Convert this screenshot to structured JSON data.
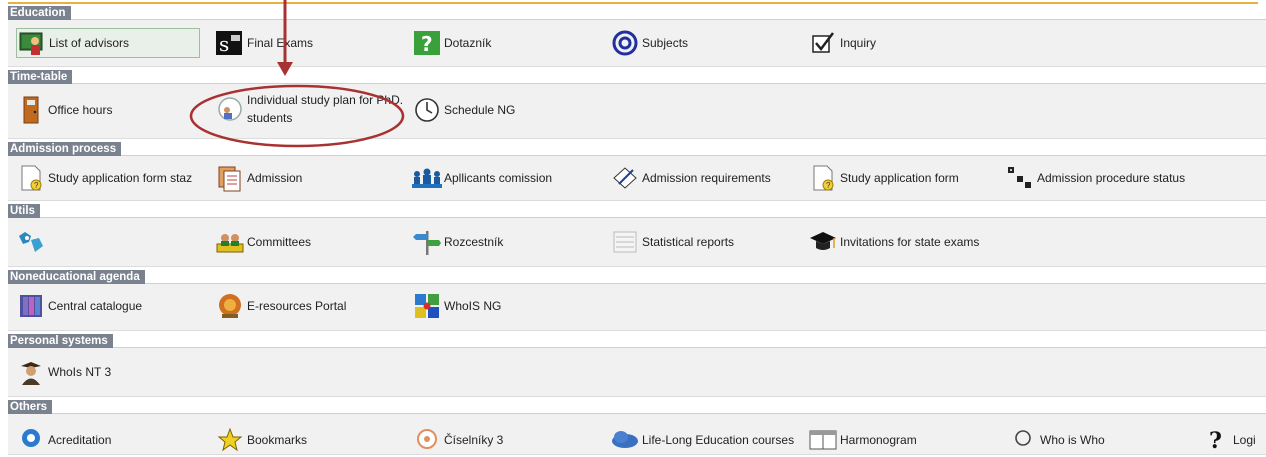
{
  "sections": [
    {
      "title": "Education",
      "items": [
        {
          "label": "List of advisors",
          "icon": "advisor-icon"
        },
        {
          "label": "Final Exams",
          "icon": "final-exams-icon"
        },
        {
          "label": "Dotazník",
          "icon": "questionnaire-icon"
        },
        {
          "label": "Subjects",
          "icon": "subjects-icon"
        },
        {
          "label": "Inquiry",
          "icon": "checkbox-icon"
        }
      ]
    },
    {
      "title": "Time-table",
      "items": [
        {
          "label": "Office hours",
          "icon": "door-icon"
        },
        {
          "label": "Individual study plan for PhD.",
          "label2": "students",
          "icon": "study-plan-icon"
        },
        {
          "label": "Schedule NG",
          "icon": "clock-icon"
        }
      ]
    },
    {
      "title": "Admission process",
      "items": [
        {
          "label": "Study application form staz",
          "icon": "application-form-icon"
        },
        {
          "label": "Admission",
          "icon": "admission-icon"
        },
        {
          "label": "Apllicants comission",
          "icon": "people-icon"
        },
        {
          "label": "Admission requirements",
          "icon": "pen-paper-icon"
        },
        {
          "label": "Study application form",
          "icon": "application-form-icon"
        },
        {
          "label": "Admission procedure status",
          "icon": "dice-icon"
        }
      ]
    },
    {
      "title": "Utils",
      "items": [
        {
          "label": "",
          "icon": "world-map-icon"
        },
        {
          "label": "Committees",
          "icon": "committee-icon"
        },
        {
          "label": "Rozcestník",
          "icon": "signpost-icon"
        },
        {
          "label": "Statistical reports",
          "icon": "report-icon"
        },
        {
          "label": "Invitations for state exams",
          "icon": "graduation-cap-icon"
        }
      ]
    },
    {
      "title": "Noneducational agenda",
      "items": [
        {
          "label": "Central catalogue",
          "icon": "books-icon"
        },
        {
          "label": "E-resources Portal",
          "icon": "portal-icon"
        },
        {
          "label": "WhoIS NG",
          "icon": "puzzle-icon"
        }
      ]
    },
    {
      "title": "Personal systems",
      "items": [
        {
          "label": "WhoIs NT 3",
          "icon": "person-hat-icon"
        }
      ]
    },
    {
      "title": "Others",
      "items": [
        {
          "label": "Acreditation",
          "icon": "accreditation-icon"
        },
        {
          "label": "Bookmarks",
          "icon": "bookmark-star-icon"
        },
        {
          "label": "Číselníky 3",
          "icon": "codebook-icon"
        },
        {
          "label": "Life-Long Education courses",
          "icon": "cloud-icon"
        },
        {
          "label": "Harmonogram",
          "icon": "calendar-icon"
        },
        {
          "label": "Who is Who",
          "icon": "magnifier-icon"
        },
        {
          "label": "Logi",
          "icon": "question-icon"
        }
      ]
    }
  ]
}
